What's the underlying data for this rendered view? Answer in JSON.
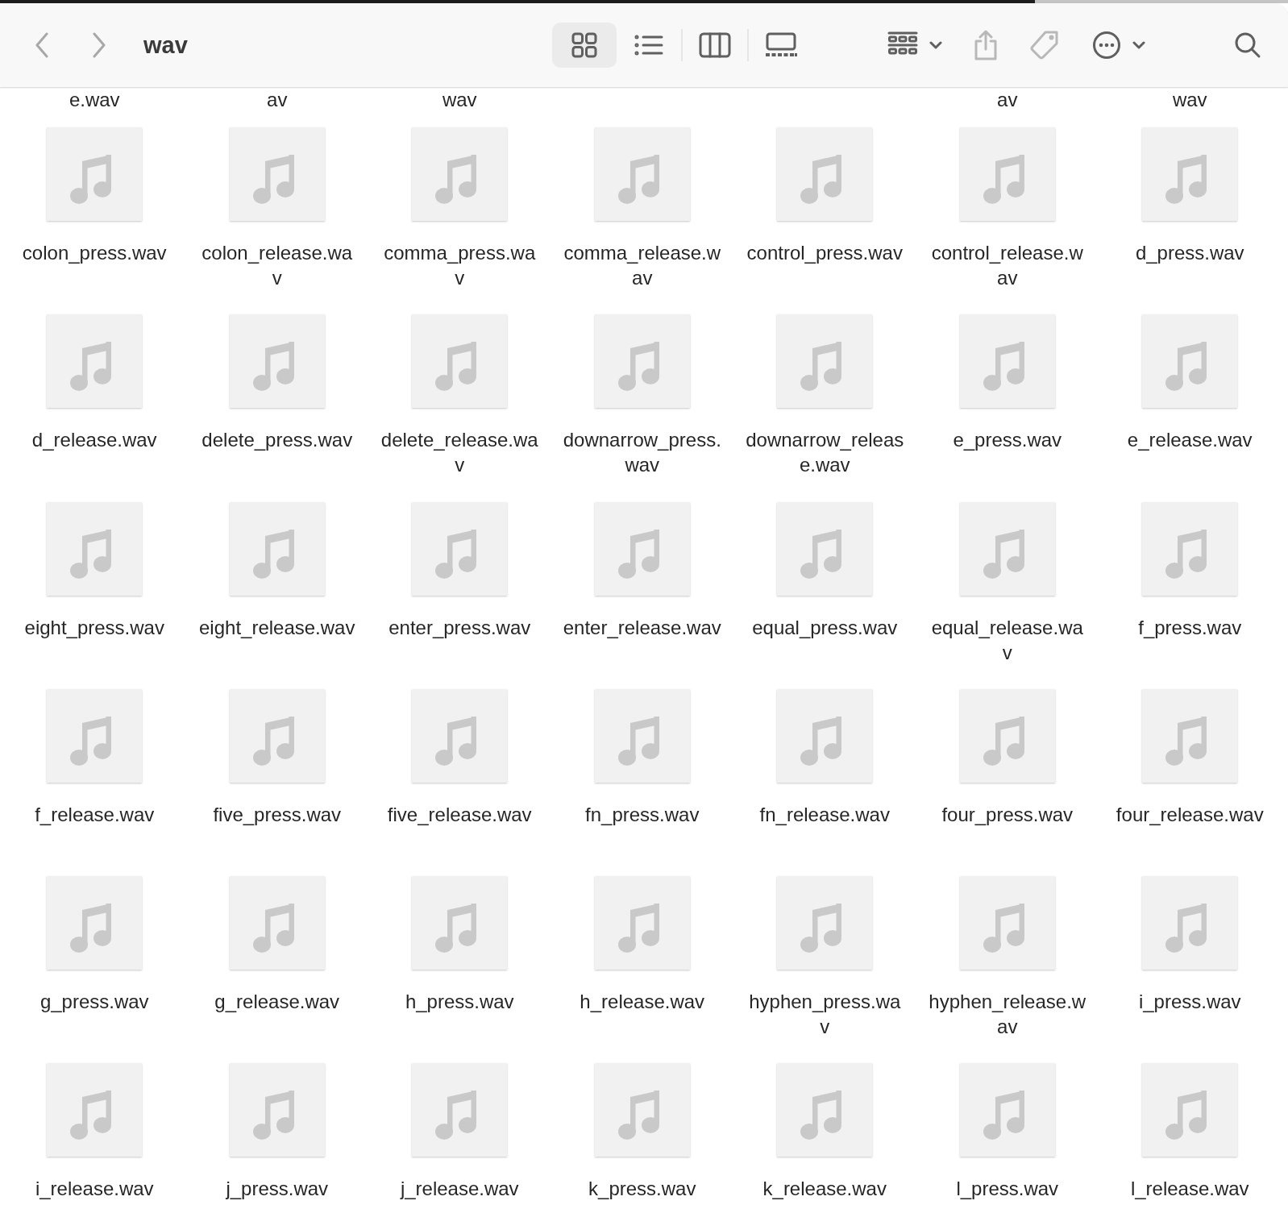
{
  "toolbar": {
    "title": "wav",
    "view_modes": [
      {
        "kind": "icons",
        "selected": true
      },
      {
        "kind": "list",
        "selected": false
      },
      {
        "kind": "columns",
        "selected": false
      },
      {
        "kind": "gallery",
        "selected": false
      }
    ],
    "actions": [
      {
        "kind": "group",
        "menu": true,
        "disabled": false
      },
      {
        "kind": "share",
        "menu": false,
        "disabled": true
      },
      {
        "kind": "tag",
        "menu": false,
        "disabled": true
      },
      {
        "kind": "more",
        "menu": true,
        "disabled": false
      },
      {
        "kind": "search",
        "menu": false,
        "disabled": false
      }
    ]
  },
  "cut_labels": [
    {
      "kind": "label",
      "text": "e.wav"
    },
    {
      "kind": "label",
      "text": "av"
    },
    {
      "kind": "label",
      "text": "wav"
    },
    {
      "kind": "gap"
    },
    {
      "kind": "gap"
    },
    {
      "kind": "label",
      "text": "av"
    },
    {
      "kind": "label",
      "text": "wav"
    }
  ],
  "files": [
    {
      "lines": [
        "colon_press.wav"
      ]
    },
    {
      "lines": [
        "colon_release.wa",
        "v"
      ]
    },
    {
      "lines": [
        "comma_press.wa",
        "v"
      ]
    },
    {
      "lines": [
        "comma_release.w",
        "av"
      ]
    },
    {
      "lines": [
        "control_press.wav"
      ]
    },
    {
      "lines": [
        "control_release.w",
        "av"
      ]
    },
    {
      "lines": [
        "d_press.wav"
      ]
    },
    {
      "lines": [
        "d_release.wav"
      ]
    },
    {
      "lines": [
        "delete_press.wav"
      ]
    },
    {
      "lines": [
        "delete_release.wa",
        "v"
      ]
    },
    {
      "lines": [
        "downarrow_press.",
        "wav"
      ]
    },
    {
      "lines": [
        "downarrow_releas",
        "e.wav"
      ]
    },
    {
      "lines": [
        "e_press.wav"
      ]
    },
    {
      "lines": [
        "e_release.wav"
      ]
    },
    {
      "lines": [
        "eight_press.wav"
      ]
    },
    {
      "lines": [
        "eight_release.wav"
      ]
    },
    {
      "lines": [
        "enter_press.wav"
      ]
    },
    {
      "lines": [
        "enter_release.wav"
      ]
    },
    {
      "lines": [
        "equal_press.wav"
      ]
    },
    {
      "lines": [
        "equal_release.wa",
        "v"
      ]
    },
    {
      "lines": [
        "f_press.wav"
      ]
    },
    {
      "lines": [
        "f_release.wav"
      ]
    },
    {
      "lines": [
        "five_press.wav"
      ]
    },
    {
      "lines": [
        "five_release.wav"
      ]
    },
    {
      "lines": [
        "fn_press.wav"
      ]
    },
    {
      "lines": [
        "fn_release.wav"
      ]
    },
    {
      "lines": [
        "four_press.wav"
      ]
    },
    {
      "lines": [
        "four_release.wav"
      ]
    },
    {
      "lines": [
        "g_press.wav"
      ]
    },
    {
      "lines": [
        "g_release.wav"
      ]
    },
    {
      "lines": [
        "h_press.wav"
      ]
    },
    {
      "lines": [
        "h_release.wav"
      ]
    },
    {
      "lines": [
        "hyphen_press.wa",
        "v"
      ]
    },
    {
      "lines": [
        "hyphen_release.w",
        "av"
      ]
    },
    {
      "lines": [
        "i_press.wav"
      ]
    },
    {
      "lines": [
        "i_release.wav"
      ]
    },
    {
      "lines": [
        "j_press.wav"
      ]
    },
    {
      "lines": [
        "j_release.wav"
      ]
    },
    {
      "lines": [
        "k_press.wav"
      ]
    },
    {
      "lines": [
        "k_release.wav"
      ]
    },
    {
      "lines": [
        "l_press.wav"
      ]
    },
    {
      "lines": [
        "l_release.wav"
      ]
    }
  ]
}
